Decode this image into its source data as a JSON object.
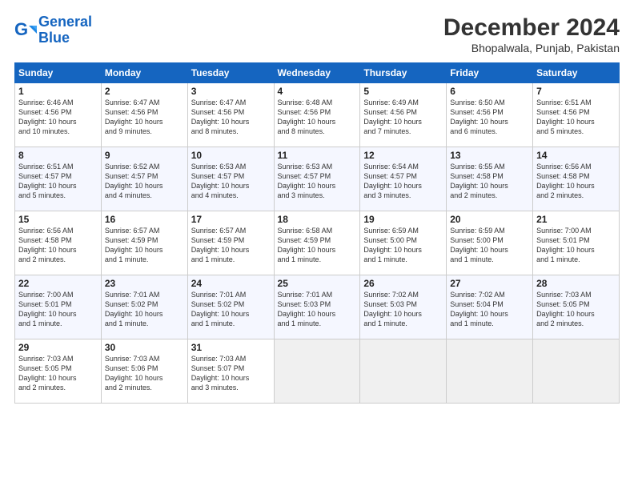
{
  "logo": {
    "line1": "General",
    "line2": "Blue"
  },
  "title": "December 2024",
  "subtitle": "Bhopalwala, Punjab, Pakistan",
  "header_days": [
    "Sunday",
    "Monday",
    "Tuesday",
    "Wednesday",
    "Thursday",
    "Friday",
    "Saturday"
  ],
  "weeks": [
    [
      {
        "day": "1",
        "info": "Sunrise: 6:46 AM\nSunset: 4:56 PM\nDaylight: 10 hours\nand 10 minutes."
      },
      {
        "day": "2",
        "info": "Sunrise: 6:47 AM\nSunset: 4:56 PM\nDaylight: 10 hours\nand 9 minutes."
      },
      {
        "day": "3",
        "info": "Sunrise: 6:47 AM\nSunset: 4:56 PM\nDaylight: 10 hours\nand 8 minutes."
      },
      {
        "day": "4",
        "info": "Sunrise: 6:48 AM\nSunset: 4:56 PM\nDaylight: 10 hours\nand 8 minutes."
      },
      {
        "day": "5",
        "info": "Sunrise: 6:49 AM\nSunset: 4:56 PM\nDaylight: 10 hours\nand 7 minutes."
      },
      {
        "day": "6",
        "info": "Sunrise: 6:50 AM\nSunset: 4:56 PM\nDaylight: 10 hours\nand 6 minutes."
      },
      {
        "day": "7",
        "info": "Sunrise: 6:51 AM\nSunset: 4:56 PM\nDaylight: 10 hours\nand 5 minutes."
      }
    ],
    [
      {
        "day": "8",
        "info": "Sunrise: 6:51 AM\nSunset: 4:57 PM\nDaylight: 10 hours\nand 5 minutes."
      },
      {
        "day": "9",
        "info": "Sunrise: 6:52 AM\nSunset: 4:57 PM\nDaylight: 10 hours\nand 4 minutes."
      },
      {
        "day": "10",
        "info": "Sunrise: 6:53 AM\nSunset: 4:57 PM\nDaylight: 10 hours\nand 4 minutes."
      },
      {
        "day": "11",
        "info": "Sunrise: 6:53 AM\nSunset: 4:57 PM\nDaylight: 10 hours\nand 3 minutes."
      },
      {
        "day": "12",
        "info": "Sunrise: 6:54 AM\nSunset: 4:57 PM\nDaylight: 10 hours\nand 3 minutes."
      },
      {
        "day": "13",
        "info": "Sunrise: 6:55 AM\nSunset: 4:58 PM\nDaylight: 10 hours\nand 2 minutes."
      },
      {
        "day": "14",
        "info": "Sunrise: 6:56 AM\nSunset: 4:58 PM\nDaylight: 10 hours\nand 2 minutes."
      }
    ],
    [
      {
        "day": "15",
        "info": "Sunrise: 6:56 AM\nSunset: 4:58 PM\nDaylight: 10 hours\nand 2 minutes."
      },
      {
        "day": "16",
        "info": "Sunrise: 6:57 AM\nSunset: 4:59 PM\nDaylight: 10 hours\nand 1 minute."
      },
      {
        "day": "17",
        "info": "Sunrise: 6:57 AM\nSunset: 4:59 PM\nDaylight: 10 hours\nand 1 minute."
      },
      {
        "day": "18",
        "info": "Sunrise: 6:58 AM\nSunset: 4:59 PM\nDaylight: 10 hours\nand 1 minute."
      },
      {
        "day": "19",
        "info": "Sunrise: 6:59 AM\nSunset: 5:00 PM\nDaylight: 10 hours\nand 1 minute."
      },
      {
        "day": "20",
        "info": "Sunrise: 6:59 AM\nSunset: 5:00 PM\nDaylight: 10 hours\nand 1 minute."
      },
      {
        "day": "21",
        "info": "Sunrise: 7:00 AM\nSunset: 5:01 PM\nDaylight: 10 hours\nand 1 minute."
      }
    ],
    [
      {
        "day": "22",
        "info": "Sunrise: 7:00 AM\nSunset: 5:01 PM\nDaylight: 10 hours\nand 1 minute."
      },
      {
        "day": "23",
        "info": "Sunrise: 7:01 AM\nSunset: 5:02 PM\nDaylight: 10 hours\nand 1 minute."
      },
      {
        "day": "24",
        "info": "Sunrise: 7:01 AM\nSunset: 5:02 PM\nDaylight: 10 hours\nand 1 minute."
      },
      {
        "day": "25",
        "info": "Sunrise: 7:01 AM\nSunset: 5:03 PM\nDaylight: 10 hours\nand 1 minute."
      },
      {
        "day": "26",
        "info": "Sunrise: 7:02 AM\nSunset: 5:03 PM\nDaylight: 10 hours\nand 1 minute."
      },
      {
        "day": "27",
        "info": "Sunrise: 7:02 AM\nSunset: 5:04 PM\nDaylight: 10 hours\nand 1 minute."
      },
      {
        "day": "28",
        "info": "Sunrise: 7:03 AM\nSunset: 5:05 PM\nDaylight: 10 hours\nand 2 minutes."
      }
    ],
    [
      {
        "day": "29",
        "info": "Sunrise: 7:03 AM\nSunset: 5:05 PM\nDaylight: 10 hours\nand 2 minutes."
      },
      {
        "day": "30",
        "info": "Sunrise: 7:03 AM\nSunset: 5:06 PM\nDaylight: 10 hours\nand 2 minutes."
      },
      {
        "day": "31",
        "info": "Sunrise: 7:03 AM\nSunset: 5:07 PM\nDaylight: 10 hours\nand 3 minutes."
      },
      {
        "day": "",
        "info": ""
      },
      {
        "day": "",
        "info": ""
      },
      {
        "day": "",
        "info": ""
      },
      {
        "day": "",
        "info": ""
      }
    ]
  ]
}
